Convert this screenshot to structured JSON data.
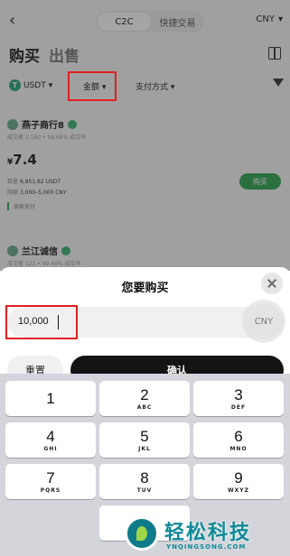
{
  "background": {
    "back_icon": "chevron-left-icon",
    "tabs": [
      "C2C",
      "快捷交易"
    ],
    "currency": "CNY",
    "side_tabs": {
      "buy": "购买",
      "sell": "出售"
    },
    "filters": {
      "coin": "USDT",
      "amount": "金额",
      "payment": "支付方式"
    },
    "merchants": [
      {
        "name": "燕子商行8",
        "stats": "成交量 3,160 • 99.68% 成交率",
        "price_symbol": "¥",
        "price": "7.4",
        "quantity_label": "数量",
        "quantity": "6,951.62 USDT",
        "limit_label": "限额",
        "limit": "3,000–5,000 CNY",
        "payment": "商家支付",
        "buy_label": "购买"
      },
      {
        "name": "兰江诚信",
        "stats": "成交量 121 • 99.68% 成交率"
      }
    ]
  },
  "sheet": {
    "title": "您要购买",
    "amount_value": "10,000",
    "amount_unit": "CNY",
    "reset_label": "重置",
    "confirm_label": "确认"
  },
  "keypad": {
    "keys": [
      {
        "num": "1",
        "letters": ""
      },
      {
        "num": "2",
        "letters": "ABC"
      },
      {
        "num": "3",
        "letters": "DEF"
      },
      {
        "num": "4",
        "letters": "GHI"
      },
      {
        "num": "5",
        "letters": "JKL"
      },
      {
        "num": "6",
        "letters": "MNO"
      },
      {
        "num": "7",
        "letters": "PQRS"
      },
      {
        "num": "8",
        "letters": "TUV"
      },
      {
        "num": "9",
        "letters": "WXYZ"
      }
    ]
  },
  "watermark": {
    "title": "轻松科技",
    "subtitle": "YNQINGSONG.COM"
  },
  "colors": {
    "accent_green": "#2ea44f",
    "annotation_red": "#e02020",
    "confirm_black": "#141414"
  }
}
